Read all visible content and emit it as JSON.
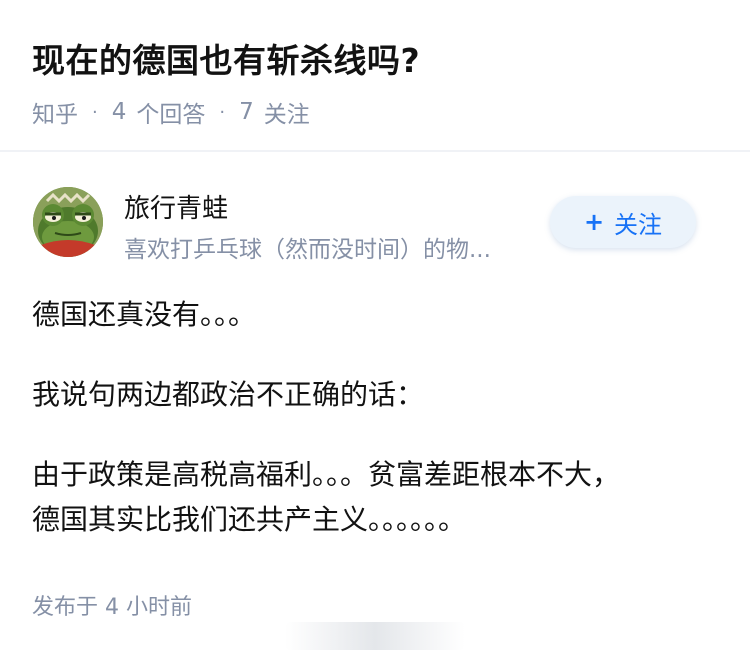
{
  "question": {
    "title": "现在的德国也有斩杀线吗?",
    "source": "知乎",
    "answer_count": "4",
    "answer_label": "个回答",
    "follower_count": "7",
    "follower_label": "关注",
    "separator": "·"
  },
  "author": {
    "name": "旅行青蛙",
    "bio": "喜欢打乒乓球（然而没时间）的物...",
    "avatar_icon": "frog-avatar-icon"
  },
  "follow_button": {
    "plus": "+",
    "label": "关注",
    "color": "#1772f6",
    "background": "#ebf3fb"
  },
  "answer": {
    "paragraphs": [
      "德国还真没有。。。",
      "我说句两边都政治不正确的话：",
      "由于政策是高税高福利。。。贫富差距根本不大，",
      "德国其实比我们还共产主义。。。。。。"
    ],
    "published": "发布于 4 小时前"
  },
  "colors": {
    "text": "#121212",
    "meta": "#8590a6",
    "divider": "#f0f2f6"
  }
}
